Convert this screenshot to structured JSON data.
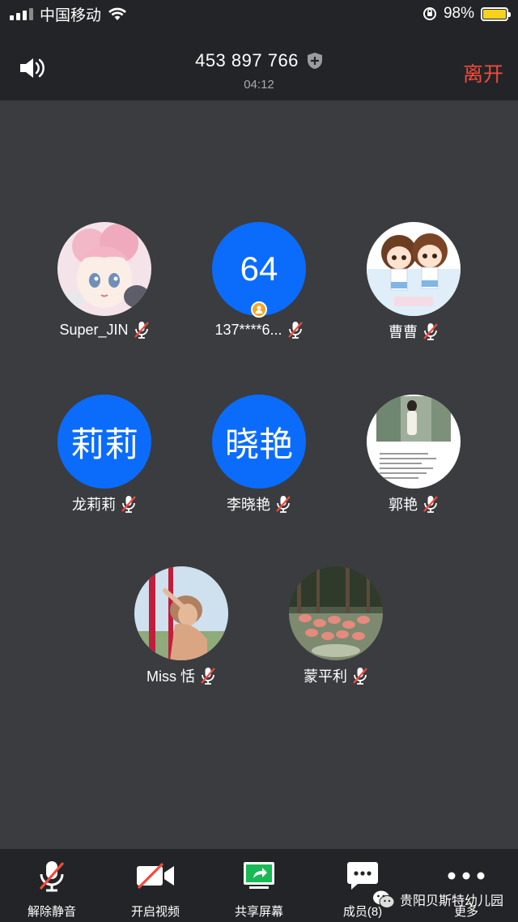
{
  "status_bar": {
    "carrier": "中国移动",
    "battery": "98%",
    "battery_level": 0.98
  },
  "header": {
    "meeting_id": "453 897 766",
    "timer": "04:12",
    "leave_label": "离开"
  },
  "participants": [
    {
      "name": "Super_JIN",
      "avatar_type": "image",
      "avatar_icon": "anime-girl-avatar",
      "muted": true
    },
    {
      "name": "137****6...",
      "avatar_type": "text",
      "avatar_text": "64",
      "host": true,
      "muted": true
    },
    {
      "name": "曹曹",
      "avatar_type": "image",
      "avatar_icon": "cartoon-girls-avatar",
      "muted": true
    },
    {
      "name": "龙莉莉",
      "avatar_type": "text",
      "avatar_text": "莉莉",
      "muted": true
    },
    {
      "name": "李晓艳",
      "avatar_type": "text",
      "avatar_text": "晓艳",
      "muted": true
    },
    {
      "name": "郭艳",
      "avatar_type": "image",
      "avatar_icon": "photo-avatar",
      "muted": true
    },
    {
      "name": "Miss 恬",
      "avatar_type": "image",
      "avatar_icon": "photo-avatar",
      "muted": true
    },
    {
      "name": "蒙平利",
      "avatar_type": "image",
      "avatar_icon": "flamingo-photo-avatar",
      "muted": true
    }
  ],
  "toolbar": {
    "unmute": "解除静音",
    "start_video": "开启视频",
    "share_screen": "共享屏幕",
    "members": "成员(8)",
    "more": "更多"
  },
  "watermark": "贵阳贝斯特幼儿园",
  "colors": {
    "background": "#3a3c3f",
    "bar": "#232427",
    "accent_blue": "#0b6cfb",
    "leave_red": "#f24a3d",
    "share_green": "#19b955",
    "mute_red": "#f24a3d"
  }
}
